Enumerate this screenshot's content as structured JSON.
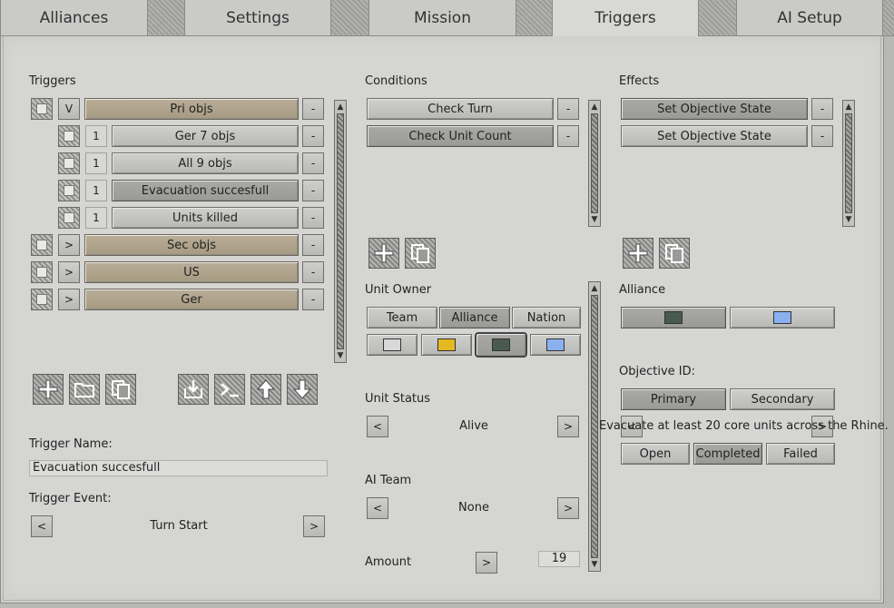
{
  "tabs": [
    {
      "label": "Alliances",
      "active": false
    },
    {
      "label": "Settings",
      "active": false
    },
    {
      "label": "Mission",
      "active": false
    },
    {
      "label": "Triggers",
      "active": true
    },
    {
      "label": "AI Setup",
      "active": false
    }
  ],
  "triggers": {
    "heading": "Triggers",
    "groups": [
      {
        "toggle": "V",
        "label": "Pri objs",
        "remove": "-"
      },
      {
        "toggle": ">",
        "label": "Sec objs",
        "remove": "-"
      },
      {
        "toggle": ">",
        "label": "US",
        "remove": "-"
      },
      {
        "toggle": ">",
        "label": "Ger",
        "remove": "-"
      }
    ],
    "children": [
      {
        "count": "1",
        "label": "Ger 7 objs",
        "remove": "-"
      },
      {
        "count": "1",
        "label": "All 9 objs",
        "remove": "-"
      },
      {
        "count": "1",
        "label": "Evacuation succesfull",
        "remove": "-",
        "selected": true
      },
      {
        "count": "1",
        "label": "Units killed",
        "remove": "-"
      }
    ],
    "toolbar_icons": [
      "add-icon",
      "folder-icon",
      "copy-icon",
      "import-icon",
      "console-icon",
      "arrow-up-icon",
      "arrow-down-icon"
    ],
    "name_label": "Trigger Name:",
    "name_value": "Evacuation succesfull",
    "event_label": "Trigger Event:",
    "event_prev": "<",
    "event_value": "Turn Start",
    "event_next": ">"
  },
  "conditions": {
    "heading": "Conditions",
    "items": [
      {
        "label": "Check Turn",
        "remove": "-"
      },
      {
        "label": "Check Unit Count",
        "remove": "-"
      }
    ],
    "unit_owner_label": "Unit Owner",
    "owner_modes": [
      "Team",
      "Alliance",
      "Nation"
    ],
    "owner_selected": "Alliance",
    "owner_colors": [
      "#d8d8d8",
      "#e4b820",
      "#4a5a50",
      "#8ab0f0"
    ],
    "owner_color_selected": 2,
    "unit_status_label": "Unit Status",
    "unit_status_prev": "<",
    "unit_status_value": "Alive",
    "unit_status_next": ">",
    "ai_team_label": "AI Team",
    "ai_team_prev": "<",
    "ai_team_value": "None",
    "ai_team_next": ">",
    "amount_label": "Amount",
    "amount_toggle": ">",
    "amount_value": "19"
  },
  "effects": {
    "heading": "Effects",
    "items": [
      {
        "label": "Set Objective State",
        "remove": "-"
      },
      {
        "label": "Set Objective State",
        "remove": "-"
      }
    ],
    "alliance_label": "Alliance",
    "alliance_colors": [
      "#4a5a50",
      "#8ab0f0"
    ],
    "objective_id_label": "Objective ID:",
    "objective_types": [
      "Primary",
      "Secondary"
    ],
    "objective_type_selected": "Primary",
    "objective_prev": "<",
    "objective_text": "Evacuate at least 20 core units across the Rhine.",
    "objective_next": ">",
    "states": [
      "Open",
      "Completed",
      "Failed"
    ],
    "state_selected": "Completed"
  }
}
